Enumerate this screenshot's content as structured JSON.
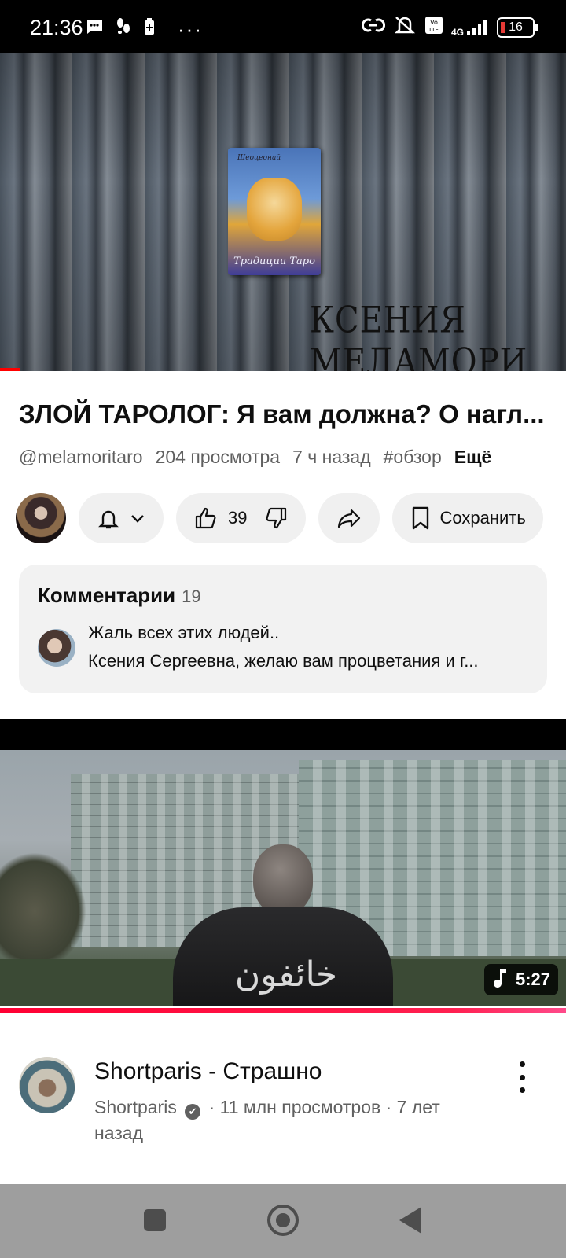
{
  "status_bar": {
    "time": "21:36",
    "network": "4G",
    "battery": "16",
    "icons": [
      "message-icon",
      "steps-icon",
      "battery-saver-icon",
      "more-dots-icon",
      "link-icon",
      "mute-icon",
      "volte-icon",
      "signal-icon",
      "battery-icon"
    ],
    "more": "···"
  },
  "video_player": {
    "thumbnail_watermark": "КСЕНИЯ МЕЛАМОРИ",
    "tarot_box_top": "Шеоцеонай",
    "tarot_box_label": "Традиции Таро",
    "accent_color": "#ff0000"
  },
  "video": {
    "title": "ЗЛОЙ ТАРОЛОГ: Я вам должна? О нагл...",
    "channel": "@melamoritaro",
    "views": "204 просмотра",
    "time_ago": "7 ч назад",
    "hashtag": "#обзор",
    "more_label": "Ещё"
  },
  "actions": {
    "likes": "39",
    "save_label": "Сохранить"
  },
  "comments": {
    "title": "Комментарии",
    "count": "19",
    "line1": "Жаль всех этих людей..",
    "line2": "Ксения Сергеевна, желаю вам процветания и г..."
  },
  "next_video": {
    "duration": "5:27",
    "thumbnail_text": "خائفون",
    "title": "Shortparis - Страшно",
    "channel": "Shortparis",
    "verified": "✔",
    "views": "· 11 млн просмотров · 7 лет назад",
    "progress_color": "#ff0033"
  }
}
